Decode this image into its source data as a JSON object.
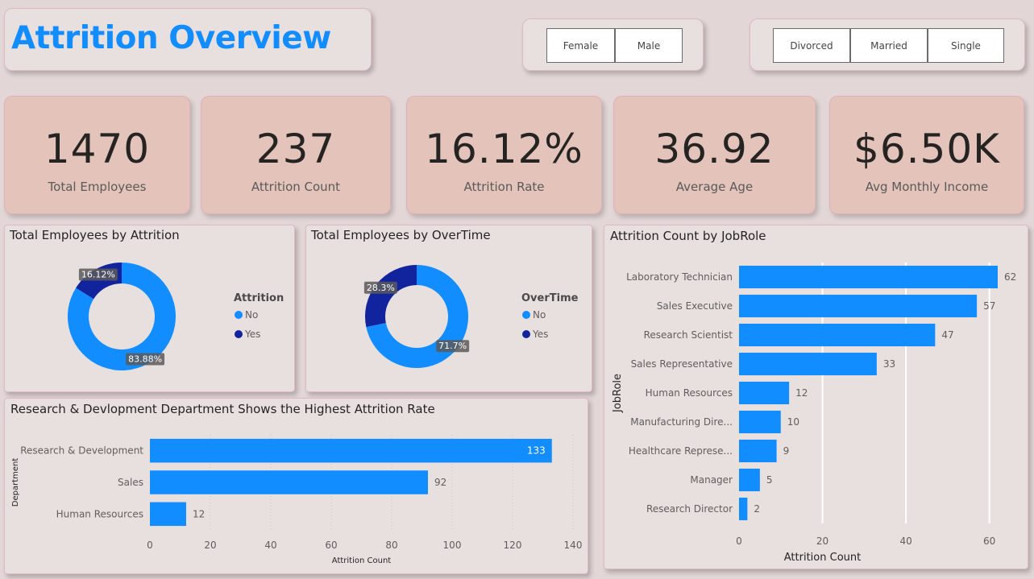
{
  "header": {
    "title": "Attrition Overview",
    "title_color": "#118dff"
  },
  "slicers": {
    "gender": [
      "Female",
      "Male"
    ],
    "marital_status": [
      "Divorced",
      "Married",
      "Single"
    ]
  },
  "kpis": [
    {
      "value": "1470",
      "label": "Total Employees"
    },
    {
      "value": "237",
      "label": "Attrition Count"
    },
    {
      "value": "16.12%",
      "label": "Attrition Rate"
    },
    {
      "value": "36.92",
      "label": "Average Age"
    },
    {
      "value": "$6.50K",
      "label": "Avg Monthly Income"
    }
  ],
  "colors": {
    "primary": "#118dff",
    "secondary": "#12239e",
    "kpi_bg": "#e3c3ba"
  },
  "chart_data": [
    {
      "id": "attrition-donut",
      "type": "pie",
      "title": "Total Employees by Attrition",
      "legend_title": "Attrition",
      "legend_position": "right",
      "slices": [
        {
          "name": "No",
          "value": 83.88,
          "label": "83.88%",
          "color": "#118dff"
        },
        {
          "name": "Yes",
          "value": 16.12,
          "label": "16.12%",
          "color": "#12239e"
        }
      ]
    },
    {
      "id": "overtime-donut",
      "type": "pie",
      "title": "Total Employees by OverTime",
      "legend_title": "OverTime",
      "legend_position": "right",
      "slices": [
        {
          "name": "No",
          "value": 71.7,
          "label": "71.7%",
          "color": "#118dff"
        },
        {
          "name": "Yes",
          "value": 28.3,
          "label": "28.3%",
          "color": "#12239e"
        }
      ]
    },
    {
      "id": "department-bar",
      "type": "bar",
      "orientation": "horizontal",
      "title": "Research & Devlopment Department Shows the Highest Attrition Rate",
      "xlabel": "Attrition Count",
      "ylabel": "Department",
      "xlim": [
        0,
        140
      ],
      "xticks": [
        0,
        20,
        40,
        60,
        80,
        100,
        120,
        140
      ],
      "grid": true,
      "categories": [
        "Research & Development",
        "Sales",
        "Human Resources"
      ],
      "values": [
        133,
        92,
        12
      ]
    },
    {
      "id": "jobrole-bar",
      "type": "bar",
      "orientation": "horizontal",
      "title": "Attrition Count by JobRole",
      "xlabel": "Attrition Count",
      "ylabel": "JobRole",
      "xlim": [
        0,
        62
      ],
      "xticks": [
        0,
        20,
        40,
        60
      ],
      "grid": true,
      "categories": [
        "Laboratory Technician",
        "Sales Executive",
        "Research Scientist",
        "Sales Representative",
        "Human Resources",
        "Manufacturing Dire...",
        "Healthcare Represe...",
        "Manager",
        "Research Director"
      ],
      "values": [
        62,
        57,
        47,
        33,
        12,
        10,
        9,
        5,
        2
      ]
    }
  ]
}
